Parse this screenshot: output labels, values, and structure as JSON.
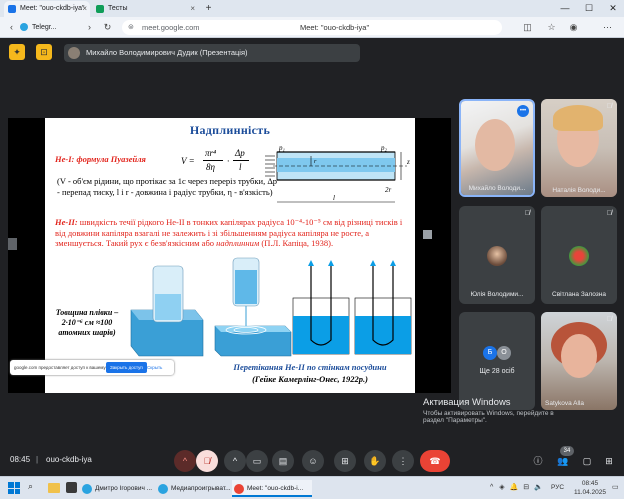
{
  "tabs": [
    {
      "label": "Meet: \"ouo-ckdb-iya\"",
      "active": true
    },
    {
      "label": "Telegr...",
      "active": false
    },
    {
      "label": "Тесты",
      "active": false
    }
  ],
  "window": {
    "minimize": "—",
    "maximize": "☐",
    "close": "✕"
  },
  "address": {
    "url": "meet.google.com",
    "page_title": "Meet: \"ouo-ckdb-iya\""
  },
  "meet": {
    "presenter_label": "Михайло Володимирович Дудик (Презентація)"
  },
  "slide": {
    "title": "Надплинність",
    "he1_label": "Не-І: формула Пуазейля",
    "formula_v": "V =",
    "formula_num": "πr⁴",
    "formula_den": "8η",
    "formula_num2": "Δp",
    "formula_den2": "l",
    "he1_desc": "(V - об'єм рідини, що протікає за 1с через переріз трубки, Δр - перепад тиску, l і r - довжина і радіус трубки, η - в'язкість)",
    "he2_label": "Не-ІІ:",
    "he2_text": " швидкість течії рідкого Не-ІІ в тонких капілярах радіуса 10⁻⁴-10⁻⁵ см від різниці тисків і від довжини капіляра взагалі не залежить і зі збільшенням радіуса капіляра не росте, а зменшується. Такий рух є безв'язкісним або ",
    "he2_italic": "надплинним",
    "he2_cite": " (П.Л. Капіца, 1938).",
    "film_label": "Товщина плівки – 2·10⁻⁶ см ≈100 атомних шарів)",
    "caption1": "Перетікання Не-ІІ по стінкам посудини",
    "caption2": "(Гейке Камерлінг-Онес, 1922р.)",
    "diagram_p1": "p₁",
    "diagram_p2": "p₂",
    "diagram_z": "z",
    "diagram_r": "r",
    "diagram_2r": "2r",
    "diagram_l": "l"
  },
  "share_banner": {
    "text": "google.com предоставляет доступ к вашему экрану.",
    "stop_button": "Закрыть доступ",
    "hide_button": "Скрыть"
  },
  "participants": [
    {
      "name": "Михайло Володи...",
      "kind": "video",
      "speaking": true
    },
    {
      "name": "Наталія Володи...",
      "kind": "video",
      "muted": true
    },
    {
      "name": "Юлія Володими...",
      "kind": "avatar",
      "muted": true
    },
    {
      "name": "Світлана Залозна",
      "kind": "avatar",
      "muted": true
    },
    {
      "name": "Ще 28 осіб",
      "kind": "more",
      "avatars": [
        "Б",
        "О"
      ]
    },
    {
      "name": "Satykova Alla",
      "kind": "video",
      "muted": true
    }
  ],
  "activation": {
    "title": "Активация Windows",
    "text1": "Чтобы активировать Windows, перейдите в",
    "text2": "раздел \"Параметры\"."
  },
  "bottom": {
    "time": "08:45",
    "separator": "|",
    "meeting_code": "ouo-ckdb-iya",
    "people_badge": "34"
  },
  "taskbar": {
    "items": [
      {
        "label": "Дмитро Ігорович ..."
      },
      {
        "label": "Медиапроигрыват..."
      },
      {
        "label": "Meet: \"ouo-ckdb-i..."
      }
    ],
    "lang": "РУС",
    "clock_time": "08:45",
    "clock_date": "11.04.2025"
  },
  "colors": {
    "meet_bg": "#202124",
    "tile_bg": "#3c4043",
    "accent_yellow": "#f5b81c",
    "end_call": "#ea4335",
    "slide_title": "#1b4c9a",
    "slide_red": "#e2241c"
  }
}
